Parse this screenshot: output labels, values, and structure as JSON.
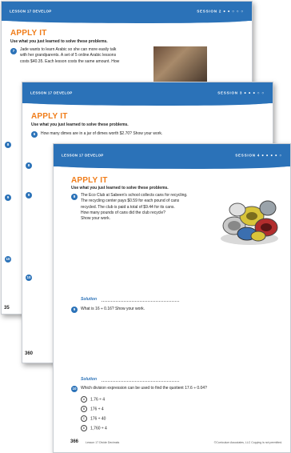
{
  "colors": {
    "header_blue": "#2b72b8",
    "title_orange": "#f07d1a"
  },
  "page1": {
    "header_left": "LESSON 17    DEVELOP",
    "header_right": "SESSION 2 ● ● ○ ○ ○",
    "title": "APPLY IT",
    "instructions": "Use what you just learned to solve these problems.",
    "q7_number": "7",
    "q7_lines": [
      "Jade wants to learn Arabic so she can more easily talk",
      "with her grandparents. A set of 5 online Arabic lessons",
      "costs $40.35. Each lesson costs the same amount. How"
    ],
    "q8_number": "8",
    "q9_number": "9",
    "q10_number": "10",
    "page_number": "35"
  },
  "page2": {
    "header_left": "LESSON 17    DEVELOP",
    "header_right": "SESSION 3 ● ● ● ○ ○",
    "title": "APPLY IT",
    "instructions": "Use what you just learned to solve these problems.",
    "q6_number": "6",
    "q6_text": "How many dimes are in a jar of dimes worth $2.70? Show your work.",
    "q8_number": "8",
    "q9_number": "9",
    "q10_number": "10",
    "page_number": "360"
  },
  "page3": {
    "header_left": "LESSON 17    DEVELOP",
    "header_right": "SESSION 4 ● ● ● ● ○",
    "title": "APPLY IT",
    "instructions": "Use what you just learned to solve these problems.",
    "q8_number": "8",
    "q8_lines": [
      "The Eco Club at Sabeen's school collects cans for recycling.",
      "The recycling center pays $0.59 for each pound of cans",
      "recycled. The club is paid a total of $9.44 for its cans.",
      "How many pounds of cans did the club recycle?",
      "Show your work."
    ],
    "solution_label_1": "Solution",
    "q9_number": "9",
    "q9_text": "What is 16 ÷ 0.16? Show your work.",
    "solution_label_2": "Solution",
    "q10_number": "10",
    "q10_text": "Which division expression can be used to find the quotient 17.6 ÷ 0.04?",
    "q10_options": [
      {
        "letter": "A",
        "text": "1.76 ÷ 4"
      },
      {
        "letter": "B",
        "text": "176 ÷ 4"
      },
      {
        "letter": "C",
        "text": "176 ÷ 40"
      },
      {
        "letter": "D",
        "text": "1,760 ÷ 4"
      }
    ],
    "page_number": "366",
    "footer_left": "Lesson 17  Divide Decimals",
    "footer_right": "©Curriculum Associates, LLC   Copying is not permitted."
  }
}
